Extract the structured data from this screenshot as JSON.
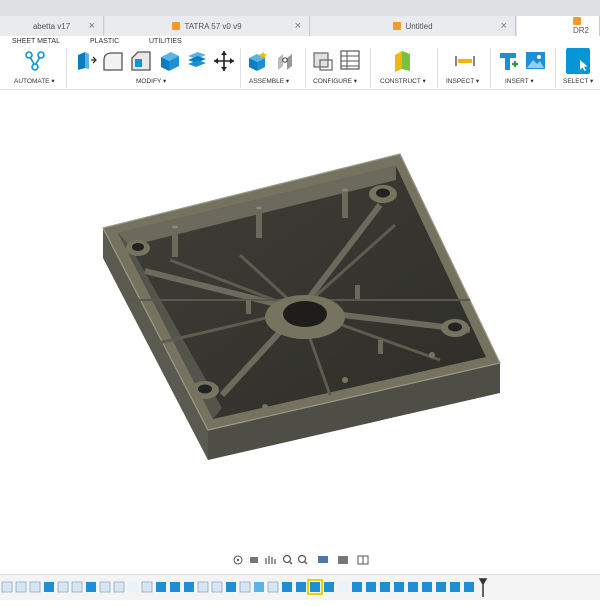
{
  "tabs": [
    {
      "label": "abetta v17",
      "has_icon": false
    },
    {
      "label": "TATRA 57 v0 v9",
      "has_icon": true
    },
    {
      "label": "Untitled",
      "has_icon": true
    },
    {
      "label": "DR2",
      "has_icon": true
    }
  ],
  "close_glyph": "×",
  "toolbar": {
    "subtabs": [
      "SHEET METAL",
      "PLASTIC",
      "UTILITIES"
    ],
    "groups": [
      "AUTOMATE ▾",
      "MODIFY ▾",
      "ASSEMBLE ▾",
      "CONFIGURE ▾",
      "CONSTRUCT ▾",
      "INSPECT ▾",
      "INSERT ▾",
      "SELECT ▾"
    ]
  },
  "colors": {
    "accent": "#0696d7",
    "model_body": "#6b695f",
    "model_dark": "#3a3933",
    "model_light": "#8a8878"
  }
}
